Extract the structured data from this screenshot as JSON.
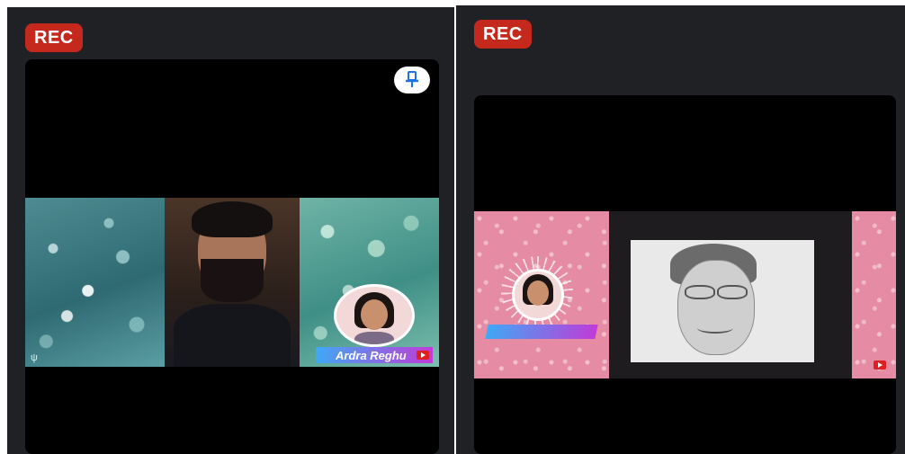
{
  "left_panel": {
    "rec_label": "REC",
    "participant_name": "Ardra Reghu",
    "pin_icon": "pin-icon",
    "youtube_icon": "youtube-icon",
    "corner_glyph": "ψ"
  },
  "right_panel": {
    "rec_label": "REC",
    "youtube_icon": "youtube-icon"
  },
  "colors": {
    "rec_badge": "#c5281c",
    "panel_bg": "#202124",
    "pin_icon": "#1a73e8",
    "nametag_start": "#3fa9f5",
    "nametag_end": "#c03bd8"
  }
}
